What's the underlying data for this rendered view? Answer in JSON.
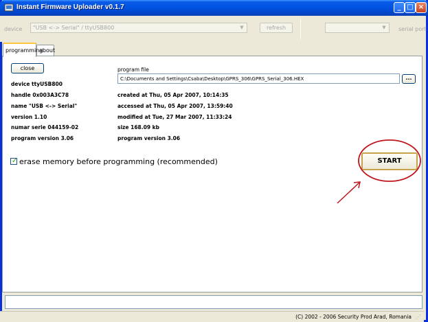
{
  "window": {
    "title": "Instant Firmware Uploader v0.1.7",
    "controls": {
      "minimize": "_",
      "maximize": "□",
      "close": "×"
    }
  },
  "toolbar": {
    "device_label": "device",
    "device_value": "\"USB <-> Serial\" / ttyUSB800",
    "refresh_label": "refresh",
    "serial_port_value": "",
    "serial_port_label": "serial port"
  },
  "tabs": [
    {
      "label": "programming",
      "active": true
    },
    {
      "label": "about",
      "active": false
    }
  ],
  "panel": {
    "close_label": "close",
    "program_file_label": "program file",
    "program_file_path": "C:\\Documents and Settings\\Csaba\\Desktop\\GPRS_306\\GPRS_Serial_306.HEX",
    "browse_label": "...",
    "device_info": [
      "device ttyUSB800",
      "handle 0x003A3C78",
      "name \"USB <-> Serial\"",
      "version 1.10",
      "numar serie 044159-02",
      "program version 3.06"
    ],
    "file_info": [
      "created at Thu, 05 Apr 2007, 10:14:35",
      "accessed at Thu, 05 Apr 2007, 13:59:40",
      "modified at Tue, 27 Mar 2007, 11:33:24",
      "size 168.09 kb",
      "program version 3.06"
    ],
    "erase_checkbox_label": "erase memory before programming (recommended)",
    "erase_checked": true,
    "start_label": "START"
  },
  "status": {
    "message": "",
    "copyright": "(C) 2002 - 2006 Security Prod Arad, Romania"
  },
  "colors": {
    "titlebar": "#0054e3",
    "annotation_red": "#c0141c",
    "start_border": "#c8a24a"
  }
}
